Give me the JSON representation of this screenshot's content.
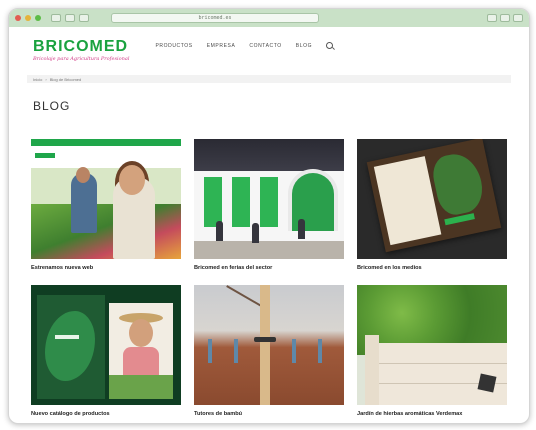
{
  "browser": {
    "url": "bricomed.es"
  },
  "header": {
    "logo": "BRICOMED",
    "tagline": "Bricolaje para Agricultura Profesional",
    "nav": [
      "PRODUCTOS",
      "EMPRESA",
      "CONTACTO",
      "BLOG"
    ]
  },
  "breadcrumb": [
    "Inicio",
    "Blog de Bricomed"
  ],
  "page": {
    "title": "BLOG"
  },
  "posts": [
    {
      "title": "Estrenamos nueva web"
    },
    {
      "title": "Bricomed en ferias del sector"
    },
    {
      "title": "Bricomed en los medios"
    },
    {
      "title": "Nuevo catálogo de productos"
    },
    {
      "title": "Tutores de bambú"
    },
    {
      "title": "Jardín de hierbas aromáticas Verdemax"
    }
  ],
  "colors": {
    "brand_green": "#1aa23f",
    "tagline_pink": "#d13a86",
    "browser_chrome": "#c9e1c7"
  }
}
